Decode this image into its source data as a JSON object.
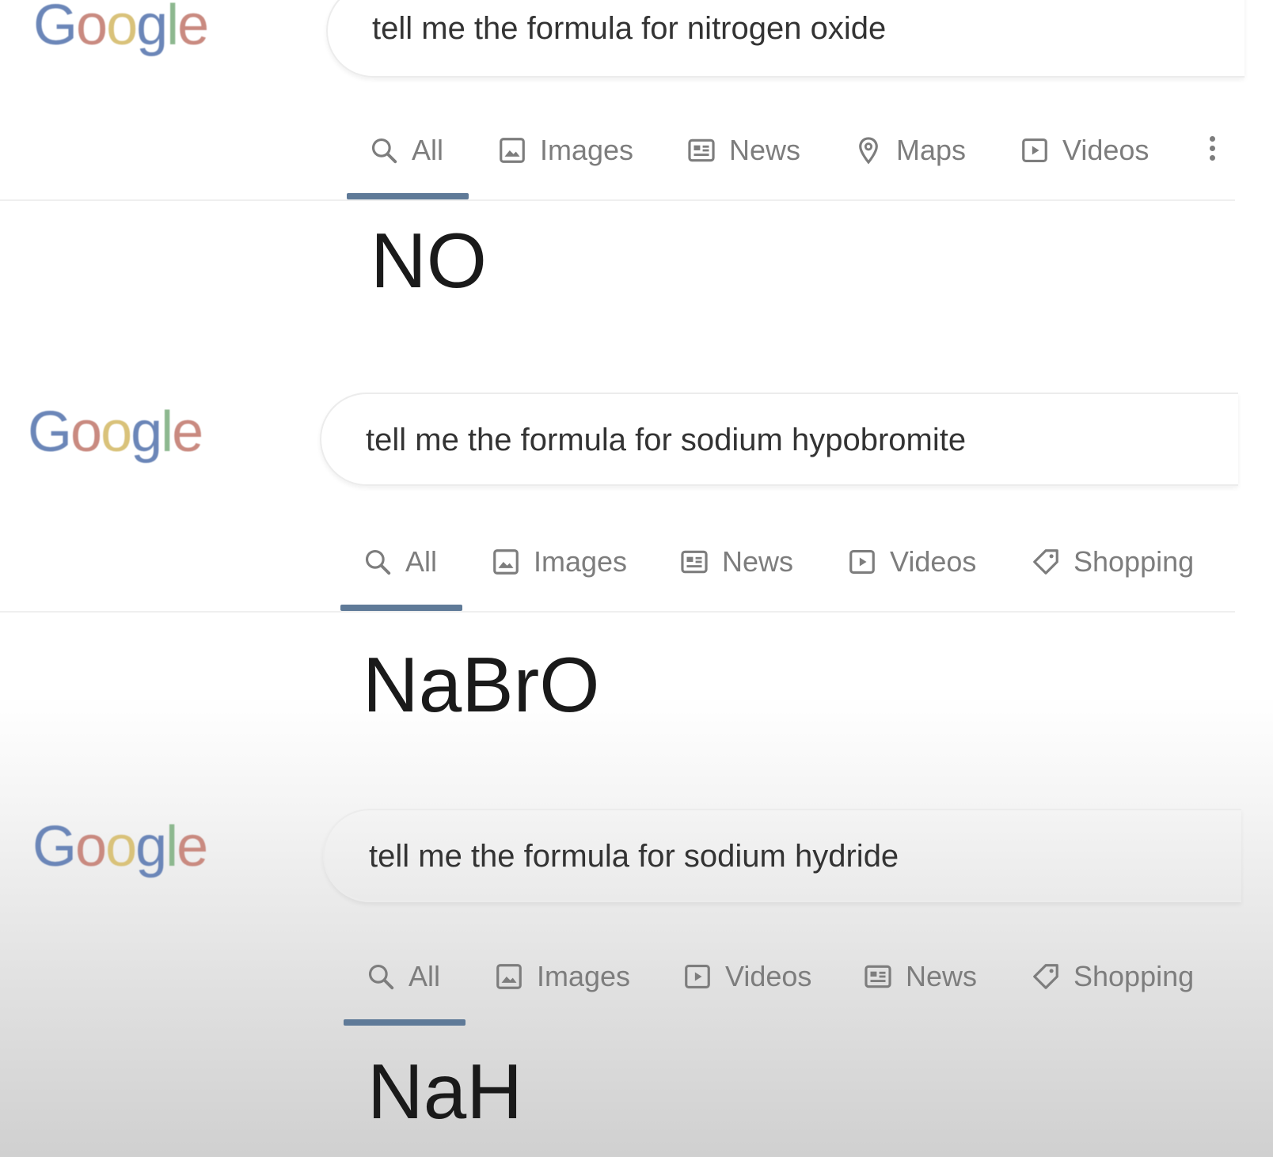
{
  "logo_text": [
    "G",
    "o",
    "o",
    "g",
    "l",
    "e"
  ],
  "panels": [
    {
      "query": "tell me the formula for nitrogen oxide",
      "tabs": [
        {
          "label": "All",
          "icon": "search-icon"
        },
        {
          "label": "Images",
          "icon": "image-icon"
        },
        {
          "label": "News",
          "icon": "news-icon"
        },
        {
          "label": "Maps",
          "icon": "map-pin-icon"
        },
        {
          "label": "Videos",
          "icon": "video-icon"
        }
      ],
      "more_icon": "more-vert-icon",
      "answer": "NO"
    },
    {
      "query": "tell me the formula for sodium hypobromite",
      "tabs": [
        {
          "label": "All",
          "icon": "search-icon"
        },
        {
          "label": "Images",
          "icon": "image-icon"
        },
        {
          "label": "News",
          "icon": "news-icon"
        },
        {
          "label": "Videos",
          "icon": "video-icon"
        },
        {
          "label": "Shopping",
          "icon": "tag-icon"
        }
      ],
      "answer": "NaBrO"
    },
    {
      "query": "tell me the formula for sodium hydride",
      "tabs": [
        {
          "label": "All",
          "icon": "search-icon"
        },
        {
          "label": "Images",
          "icon": "image-icon"
        },
        {
          "label": "Videos",
          "icon": "video-icon"
        },
        {
          "label": "News",
          "icon": "news-icon"
        },
        {
          "label": "Shopping",
          "icon": "tag-icon"
        }
      ],
      "answer": "NaH"
    }
  ],
  "colors": {
    "active_tab_underline": "#5f7a98",
    "tab_text": "#7d7d7d",
    "query_text": "#333333",
    "answer_text": "#1a1a1a"
  }
}
